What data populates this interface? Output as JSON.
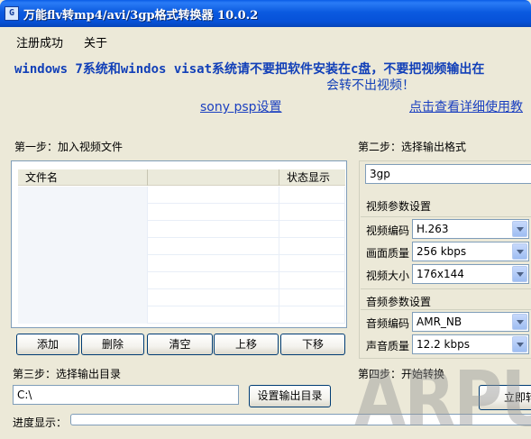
{
  "window": {
    "title": "万能flv转mp4/avi/3gp格式转换器 10.0.2",
    "icon_label": "G"
  },
  "menu": {
    "items": [
      "注册成功",
      "关于"
    ]
  },
  "notice": {
    "line1": "windows 7系统和windos visat系统请不要把软件安装在c盘，不要把视频输出在",
    "line2": "会转不出视频！"
  },
  "links": {
    "sony_psp": "sony psp设置",
    "help": "点击查看详细使用教"
  },
  "step1": {
    "label": "第一步：加入视频文件",
    "columns": [
      "文件名",
      "",
      "状态显示"
    ],
    "rows": [],
    "buttons": [
      "添加",
      "删除",
      "清空",
      "上移",
      "下移"
    ]
  },
  "step2": {
    "label": "第二步：选择输出格式",
    "format_value": "3gp",
    "video_group_label": "视频参数设置",
    "video_codec_label": "视频编码",
    "video_codec_value": "H.263",
    "video_quality_label": "画面质量",
    "video_quality_value": "256 kbps",
    "video_size_label": "视频大小",
    "video_size_value": "176x144",
    "audio_group_label": "音频参数设置",
    "audio_codec_label": "音频编码",
    "audio_codec_value": "AMR_NB",
    "audio_quality_label": "声音质量",
    "audio_quality_value": "12.2 kbps"
  },
  "step3": {
    "label": "第三步：选择输出目录",
    "path_value": "C:\\",
    "set_dir_button": "设置输出目录"
  },
  "step4": {
    "label": "第四步：开始转换",
    "start_button": "立即转"
  },
  "progress": {
    "label": "进度显示：",
    "fraction": 0
  },
  "watermark": "ARPUN",
  "colors": {
    "title_bar": "#0b5ae0",
    "window_bg": "#ece9d8",
    "notice_text": "#1240b8",
    "link_text": "#1a3fc0"
  }
}
